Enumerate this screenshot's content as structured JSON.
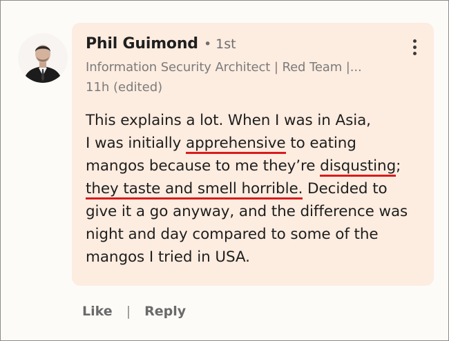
{
  "comment": {
    "author_name": "Phil Guimond",
    "connection_degree": "• 1st",
    "headline": "Information Security Architect | Red Team |...",
    "timestamp": "11h (edited)",
    "lines": [
      {
        "pre": "This explains a lot. When I was in Asia,",
        "hl": "",
        "post": ""
      },
      {
        "pre": "I was initially ",
        "hl": "apprehensive",
        "post": " to eating"
      },
      {
        "pre": "mangos because to me they’re ",
        "hl": "disqusting",
        "post": ";"
      },
      {
        "pre": "",
        "hl": "they taste and smell horrible.",
        "post": " Decided to"
      },
      {
        "pre": "give it a go anyway, and the difference was",
        "hl": "",
        "post": ""
      },
      {
        "pre": "night and day compared to some of the",
        "hl": "",
        "post": ""
      },
      {
        "pre": "mangos I tried in USA.",
        "hl": "",
        "post": ""
      }
    ],
    "highlight_color": "#d81b1b",
    "more_icon": "vertical-ellipsis-icon"
  },
  "actions": {
    "like_label": "Like",
    "separator": "|",
    "reply_label": "Reply"
  },
  "colors": {
    "card_background": "#fdece0",
    "page_background": "#fdfbf8"
  }
}
